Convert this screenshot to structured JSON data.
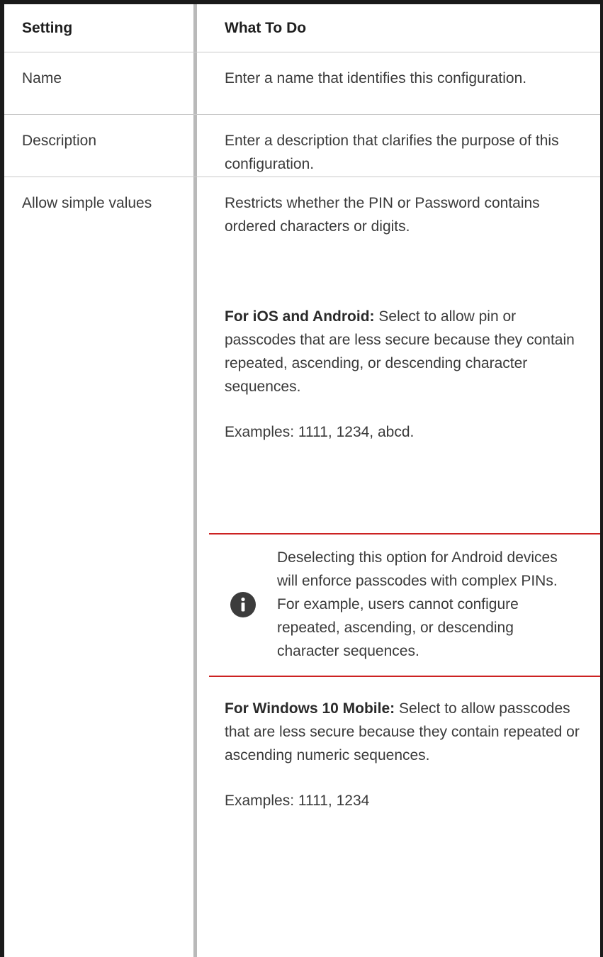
{
  "header": {
    "setting": "Setting",
    "what_to_do": "What To Do"
  },
  "rows": [
    {
      "setting": "Name",
      "what": "Enter a name that identifies this configuration."
    },
    {
      "setting": "Description",
      "what": "Enter a description that clarifies the purpose of this configuration."
    },
    {
      "setting": "Allow simple values",
      "intro": "Restricts whether the PIN or Password contains ordered characters or digits.",
      "ios_android_label": "For iOS and Android:",
      "ios_android_text": " Select to allow  pin or passcodes that are less secure because they contain repeated, ascending, or descending character sequences.",
      "examples_1": "Examples: 1111, 1234, abcd.",
      "note_icon": "info-icon",
      "note_text": "Deselecting this option for Android devices will enforce passcodes with complex PINs. For example, users cannot configure repeated, ascending, or descending character sequences.",
      "windows_label": "For Windows 10 Mobile:",
      "windows_text": " Select to allow passcodes that are less secure because they contain repeated or ascending numeric sequences.",
      "examples_2": "Examples: 1111, 1234"
    }
  ],
  "colors": {
    "note_rule": "#cc2222",
    "table_border": "#1a1a1a",
    "column_divider": "#b9b9b9"
  }
}
